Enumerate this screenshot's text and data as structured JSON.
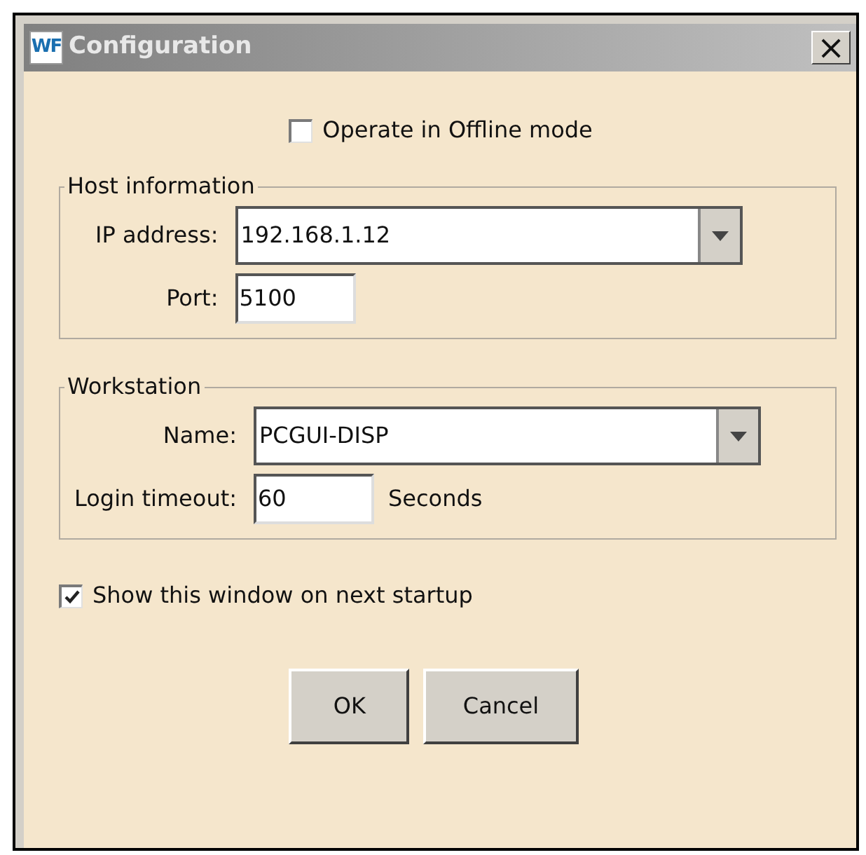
{
  "window": {
    "title": "Configuration",
    "icon_text": "WF",
    "close": "×"
  },
  "offline_mode": {
    "label": "Operate in Offline mode",
    "checked": false
  },
  "host_information": {
    "title": "Host information",
    "ip_address": {
      "label": "IP address:",
      "value": "192.168.1.12"
    },
    "port": {
      "label": "Port:",
      "value": "5100"
    }
  },
  "workstation": {
    "title": "Workstation",
    "name": {
      "label": "Name:",
      "value": "PCGUI-DISP"
    },
    "login_timeout": {
      "label": "Login timeout:",
      "value": "60",
      "unit": "Seconds"
    }
  },
  "show_on_startup": {
    "label": "Show this window on next startup",
    "checked": true
  },
  "buttons": [
    "OK",
    "Cancel"
  ]
}
